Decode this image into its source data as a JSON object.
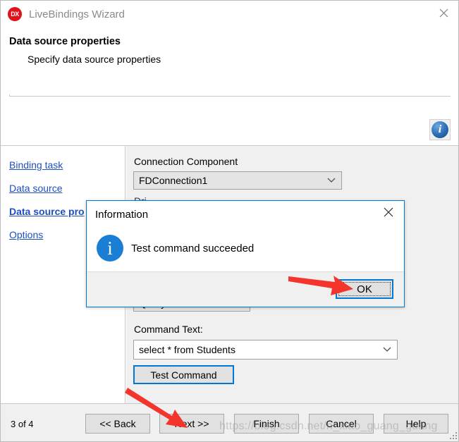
{
  "window": {
    "title": "LiveBindings Wizard",
    "logo_text": "DX",
    "close_icon": "close-icon"
  },
  "header": {
    "title": "Data source properties",
    "subtitle": "Specify data source properties",
    "info_icon": "info-icon",
    "info_glyph": "i"
  },
  "sidebar": {
    "items": [
      {
        "label": "Binding task",
        "current": false
      },
      {
        "label": "Data source",
        "current": false
      },
      {
        "label": "Data source pro",
        "current": true
      },
      {
        "label": "Options",
        "current": false
      }
    ]
  },
  "main": {
    "connection_label": "Connection Component",
    "connection_value": "FDConnection1",
    "hidden_label": "Dri",
    "command_type_value": "Query",
    "command_text_label": "Command Text:",
    "command_text_value": "select * from Students",
    "test_command_label": "Test Command",
    "chevron_icon": "chevron-down-icon"
  },
  "dialog": {
    "title": "Information",
    "message": "Test command succeeded",
    "ok_label": "OK",
    "info_glyph": "i",
    "close_icon": "close-icon"
  },
  "footer": {
    "step_text": "3 of 4",
    "buttons": [
      {
        "label": "<< Back"
      },
      {
        "label": "Next >>"
      },
      {
        "label": "Finish"
      },
      {
        "label": "Cancel"
      },
      {
        "label": "Help"
      }
    ]
  },
  "watermark": {
    "text": "https://blog.csdn.net/n_xiao_guang_guang"
  },
  "colors": {
    "accent": "#0078d7",
    "link": "#1f4fbf",
    "logo": "#e0121c",
    "arrow": "#f4352c",
    "panel": "#f0f0f0"
  }
}
